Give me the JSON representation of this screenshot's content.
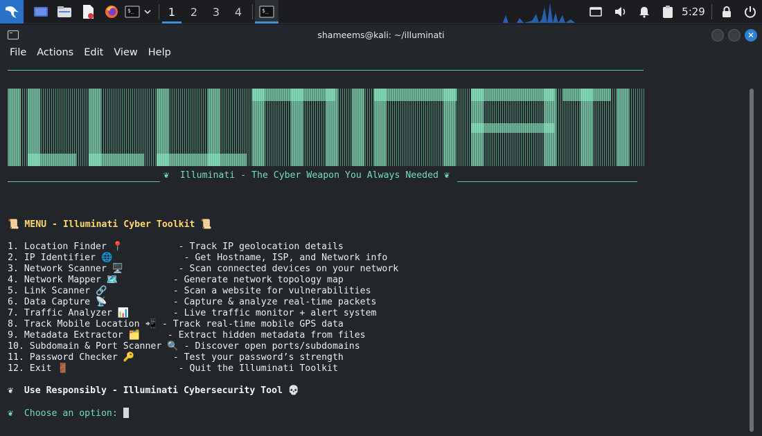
{
  "panel": {
    "workspaces": [
      "1",
      "2",
      "3",
      "4"
    ],
    "active_workspace": "1",
    "clock": "5:29"
  },
  "window": {
    "title": "shameems@kali: ~/illuminati"
  },
  "menubar": [
    "File",
    "Actions",
    "Edit",
    "View",
    "Help"
  ],
  "terminal": {
    "banner_text": "ILLUMINATI",
    "tagline": "❦  Illuminati - The Cyber Weapon You Always Needed ❦",
    "menu_title": "📜 MENU - Illuminati Cyber Toolkit 📜",
    "options": [
      "1. Location Finder 📍          - Track IP geolocation details",
      "2. IP Identifier 🌐             - Get Hostname, ISP, and Network info",
      "3. Network Scanner 🖥️          - Scan connected devices on your network",
      "4. Network Mapper 🗺️          - Generate network topology map",
      "5. Link Scanner 🔗            - Scan a website for vulnerabilities",
      "6. Data Capture 📡            - Capture & analyze real-time packets",
      "7. Traffic Analyzer 📊        - Live traffic monitor + alert system",
      "8. Track Mobile Location 📲 - Track real-time mobile GPS data",
      "9. Metadata Extractor 🗂️     - Extract hidden metadata from files",
      "10. Subdomain & Port Scanner 🔍 - Discover open ports/subdomains",
      "11. Password Checker 🔑       - Test your password’s strength",
      "12. Exit 🚪                    - Quit the Illuminati Toolkit"
    ],
    "footer": "❦  Use Responsibly - Illuminati Cybersecurity Tool 💀",
    "prompt": "❦  Choose an option: "
  }
}
